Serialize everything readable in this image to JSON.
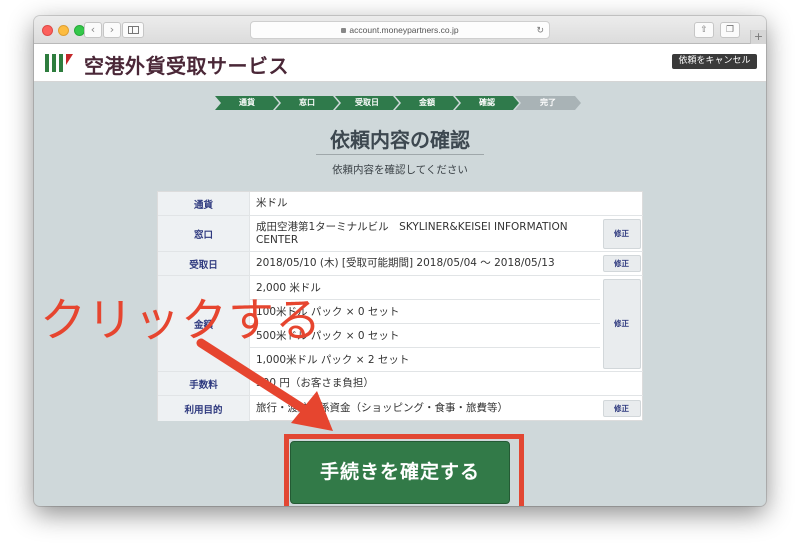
{
  "browser": {
    "url": "account.moneypartners.co.jp",
    "back_symbol": "‹",
    "forward_symbol": "›",
    "share_symbol": "⇧",
    "tabs_symbol": "❐",
    "newtab_symbol": "+",
    "reload_symbol": "↻"
  },
  "header": {
    "title": "空港外貨受取サービス",
    "cancel_label": "依頼をキャンセル"
  },
  "steps": [
    {
      "label": "通貨",
      "state": "done"
    },
    {
      "label": "窓口",
      "state": "done"
    },
    {
      "label": "受取日",
      "state": "done"
    },
    {
      "label": "金額",
      "state": "done"
    },
    {
      "label": "確認",
      "state": "current"
    },
    {
      "label": "完了",
      "state": "future"
    }
  ],
  "page": {
    "title": "依頼内容の確認",
    "subtitle": "依頼内容を確認してください"
  },
  "details": {
    "currency": {
      "label": "通貨",
      "value": "米ドル"
    },
    "counter": {
      "label": "窓口",
      "value": "成田空港第1ターミナルビル　SKYLINER&KEISEI INFORMATION CENTER",
      "edit": "修正"
    },
    "pickup_date": {
      "label": "受取日",
      "value": "2018/05/10 (木) [受取可能期間] 2018/05/04 〜 2018/05/13",
      "edit": "修正"
    },
    "amount": {
      "label": "金額",
      "lines": [
        "2,000 米ドル",
        "100米ドル パック × 0 セット",
        "500米ドル パック × 0 セット",
        "1,000米ドル パック × 2 セット"
      ],
      "edit": "修正"
    },
    "fee": {
      "label": "手数料",
      "value": "500 円（お客さま負担）"
    },
    "purpose": {
      "label": "利用目的",
      "value": "旅行・渡航関係資金（ショッピング・食事・旅費等）",
      "edit": "修正"
    }
  },
  "confirm_button": {
    "label": "手続きを確定する"
  },
  "annotation": {
    "text": "クリックする",
    "color": "#e6452f"
  }
}
